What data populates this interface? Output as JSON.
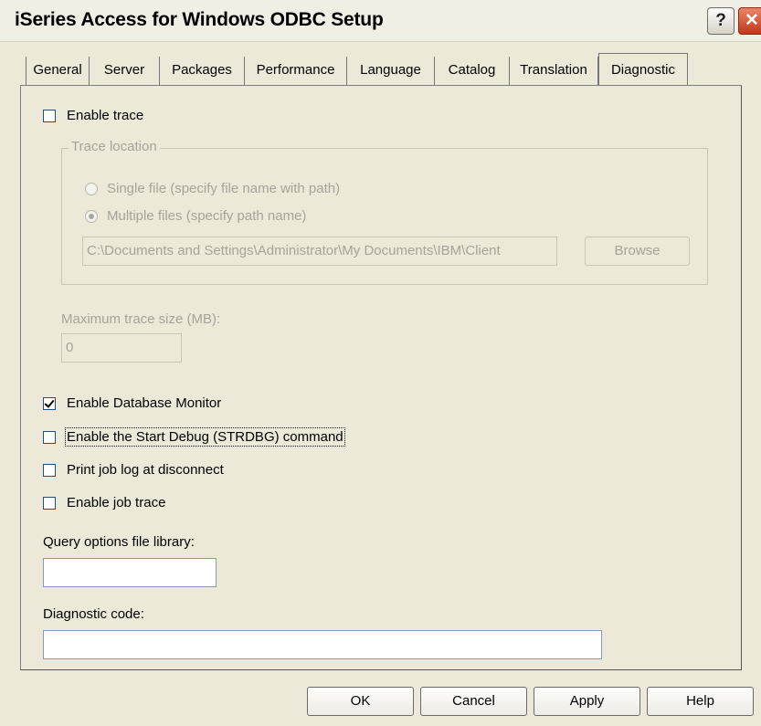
{
  "window": {
    "title": "iSeries Access for Windows ODBC Setup",
    "help_glyph": "?",
    "close_glyph": "✕"
  },
  "tabs": [
    {
      "label": "General"
    },
    {
      "label": "Server"
    },
    {
      "label": "Packages"
    },
    {
      "label": "Performance"
    },
    {
      "label": "Language"
    },
    {
      "label": "Catalog"
    },
    {
      "label": "Translation"
    },
    {
      "label": "Diagnostic",
      "active": true
    }
  ],
  "diagnostic": {
    "enable_trace": {
      "label": "Enable trace",
      "checked": false
    },
    "trace_location": {
      "legend": "Trace location",
      "single_file": {
        "label": "Single file (specify file name with path)",
        "selected": false
      },
      "multiple_files": {
        "label": "Multiple files (specify path name)",
        "selected": true
      },
      "path_value": "C:\\Documents and Settings\\Administrator\\My Documents\\IBM\\Client",
      "browse_label": "Browse"
    },
    "max_trace_size": {
      "label": "Maximum trace size (MB):",
      "value": "0"
    },
    "enable_db_monitor": {
      "label": "Enable Database Monitor",
      "checked": true
    },
    "enable_strdbg": {
      "label": "Enable the Start Debug (STRDBG) command",
      "checked": false
    },
    "print_job_log": {
      "label": "Print job log at disconnect",
      "checked": false
    },
    "enable_job_trace": {
      "label": "Enable job trace",
      "checked": false
    },
    "query_options_library": {
      "label": "Query options file library:",
      "value": ""
    },
    "diagnostic_code": {
      "label": "Diagnostic code:",
      "value": ""
    }
  },
  "footer": {
    "ok_label": "OK",
    "cancel_label": "Cancel",
    "apply_label": "Apply",
    "help_label": "Help"
  }
}
